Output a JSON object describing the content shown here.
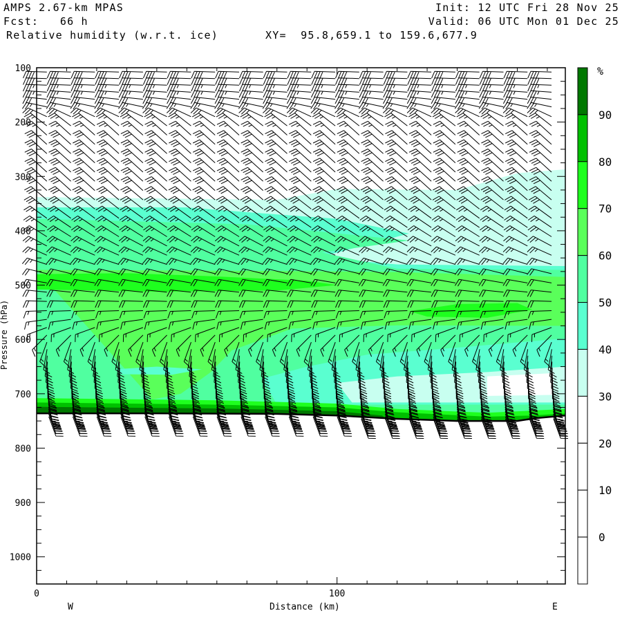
{
  "header": {
    "model": "AMPS 2.67-km MPAS",
    "forecast": "Fcst:   66 h",
    "field": "Relative humidity (w.r.t. ice)",
    "xy": "XY=  95.8,659.1 to 159.6,677.9",
    "init": "Init: 12 UTC Fri 28 Nov 25",
    "valid": "Valid: 06 UTC Mon 01 Dec 25"
  },
  "chart_data": {
    "type": "cross-section",
    "title": "Relative humidity (w.r.t. ice)",
    "xlabel": "Distance (km)",
    "ylabel": "Pressure (hPa)",
    "xlim": [
      0,
      176
    ],
    "ylim": [
      1050,
      100
    ],
    "x_ticks": [
      {
        "value": 0,
        "label": "0"
      },
      {
        "value": 100,
        "label": "100"
      }
    ],
    "x_minor_step": 10,
    "y_ticks": [
      {
        "value": 100,
        "label": "100"
      },
      {
        "value": 200,
        "label": "200"
      },
      {
        "value": 300,
        "label": "300"
      },
      {
        "value": 400,
        "label": "400"
      },
      {
        "value": 500,
        "label": "500"
      },
      {
        "value": 600,
        "label": "600"
      },
      {
        "value": 700,
        "label": "700"
      },
      {
        "value": 800,
        "label": "800"
      },
      {
        "value": 900,
        "label": "900"
      },
      {
        "value": 1000,
        "label": "1000"
      }
    ],
    "west_label": "W",
    "east_label": "E",
    "colorbar": {
      "unit": "%",
      "bins": [
        {
          "lo": 90,
          "hi": 100,
          "color": "#007800"
        },
        {
          "lo": 80,
          "hi": 90,
          "color": "#00c000"
        },
        {
          "lo": 70,
          "hi": 80,
          "color": "#1eff1e"
        },
        {
          "lo": 60,
          "hi": 70,
          "color": "#5aff5a"
        },
        {
          "lo": 50,
          "hi": 60,
          "color": "#50ffa0"
        },
        {
          "lo": 40,
          "hi": 50,
          "color": "#5affd0"
        },
        {
          "lo": 30,
          "hi": 40,
          "color": "#c8fff0"
        },
        {
          "lo": 20,
          "hi": 30,
          "color": "#ffffff"
        },
        {
          "lo": 10,
          "hi": 20,
          "color": "#ffffff"
        },
        {
          "lo": 0,
          "hi": 10,
          "color": "#ffffff"
        },
        {
          "lo": -10,
          "hi": 0,
          "color": "#ffffff"
        }
      ],
      "labels": [
        "90",
        "80",
        "70",
        "60",
        "50",
        "40",
        "30",
        "20",
        "10",
        "0"
      ]
    },
    "rh_regions": [
      {
        "rh": 35,
        "color": "#c8fff0",
        "pts": [
          [
            0,
            338
          ],
          [
            80,
            343
          ],
          [
            100,
            323
          ],
          [
            140,
            325
          ],
          [
            160,
            294
          ],
          [
            176,
            287
          ],
          [
            176,
            1050
          ],
          [
            0,
            1050
          ]
        ]
      },
      {
        "rh": 45,
        "color": "#5affd0",
        "pts": [
          [
            0,
            357
          ],
          [
            50,
            357
          ],
          [
            80,
            370
          ],
          [
            100,
            378
          ],
          [
            124,
            405
          ],
          [
            94,
            449
          ],
          [
            120,
            462
          ],
          [
            176,
            465
          ],
          [
            176,
            1050
          ],
          [
            0,
            1050
          ]
        ]
      },
      {
        "rh": 55,
        "color": "#50ffa0",
        "pts": [
          [
            0,
            378
          ],
          [
            70,
            388
          ],
          [
            124,
            418
          ],
          [
            95,
            440
          ],
          [
            120,
            470
          ],
          [
            176,
            472
          ],
          [
            176,
            1050
          ],
          [
            0,
            1050
          ]
        ]
      },
      {
        "rh": 65,
        "color": "#5aff5a",
        "pts": [
          [
            0,
            472
          ],
          [
            80,
            474
          ],
          [
            120,
            476
          ],
          [
            176,
            485
          ],
          [
            176,
            575
          ],
          [
            120,
            574
          ],
          [
            85,
            580
          ],
          [
            65,
            620
          ],
          [
            58,
            660
          ],
          [
            48,
            700
          ],
          [
            30,
            720
          ],
          [
            0,
            725
          ],
          [
            0,
            1050
          ],
          [
            40,
            1050
          ],
          [
            40,
            720
          ]
        ]
      },
      {
        "rh": 75,
        "color": "#1eff1e",
        "pts": [
          [
            0,
            480
          ],
          [
            30,
            478
          ],
          [
            60,
            484
          ],
          [
            90,
            492
          ],
          [
            100,
            500
          ],
          [
            80,
            510
          ],
          [
            40,
            512
          ],
          [
            0,
            508
          ]
        ]
      },
      {
        "rh": 75,
        "color": "#1eff1e",
        "pts": [
          [
            124,
            548
          ],
          [
            140,
            535
          ],
          [
            160,
            533
          ],
          [
            165,
            545
          ],
          [
            150,
            560
          ],
          [
            130,
            558
          ]
        ]
      },
      {
        "rh": 45,
        "color": "#5affd0",
        "pts": [
          [
            176,
            598
          ],
          [
            140,
            615
          ],
          [
            110,
            628
          ],
          [
            90,
            650
          ],
          [
            75,
            672
          ],
          [
            80,
            720
          ],
          [
            176,
            720
          ]
        ]
      },
      {
        "rh": 45,
        "color": "#5affd0",
        "pts": [
          [
            26,
            655
          ],
          [
            40,
            650
          ],
          [
            55,
            655
          ],
          [
            45,
            665
          ],
          [
            28,
            664
          ]
        ]
      },
      {
        "rh": 35,
        "color": "#c8fff0",
        "pts": [
          [
            176,
            650
          ],
          [
            150,
            660
          ],
          [
            120,
            668
          ],
          [
            100,
            680
          ],
          [
            105,
            716
          ],
          [
            176,
            716
          ]
        ]
      },
      {
        "rh": 25,
        "color": "#ffffff",
        "pts": [
          [
            150,
            668
          ],
          [
            172,
            662
          ],
          [
            172,
            702
          ],
          [
            150,
            704
          ]
        ]
      },
      {
        "rh": 75,
        "color": "#1eff1e",
        "pts": [
          [
            0,
            708
          ],
          [
            60,
            712
          ],
          [
            100,
            718
          ],
          [
            120,
            728
          ],
          [
            150,
            735
          ],
          [
            176,
            728
          ],
          [
            176,
            760
          ],
          [
            0,
            760
          ]
        ]
      },
      {
        "rh": 85,
        "color": "#00c000",
        "pts": [
          [
            0,
            716
          ],
          [
            60,
            720
          ],
          [
            100,
            725
          ],
          [
            120,
            734
          ],
          [
            150,
            742
          ],
          [
            165,
            740
          ],
          [
            176,
            736
          ],
          [
            176,
            760
          ],
          [
            0,
            760
          ]
        ]
      },
      {
        "rh": 95,
        "color": "#007800",
        "pts": [
          [
            0,
            724
          ],
          [
            60,
            727
          ],
          [
            100,
            732
          ],
          [
            115,
            740
          ],
          [
            120,
            760
          ],
          [
            0,
            760
          ]
        ]
      }
    ],
    "terrain": [
      [
        0,
        736
      ],
      [
        40,
        736
      ],
      [
        80,
        737
      ],
      [
        100,
        740
      ],
      [
        120,
        746
      ],
      [
        140,
        750
      ],
      [
        160,
        750
      ],
      [
        166,
        745
      ],
      [
        176,
        740
      ]
    ],
    "wind_columns": {
      "start_km": 3.4,
      "step_km": 8.0,
      "count": 22
    },
    "wind_levels": [
      {
        "p": 108,
        "dir": 272,
        "spd": 40
      },
      {
        "p": 120,
        "dir": 272,
        "spd": 40
      },
      {
        "p": 132,
        "dir": 272,
        "spd": 35
      },
      {
        "p": 145,
        "dir": 274,
        "spd": 35
      },
      {
        "p": 158,
        "dir": 276,
        "spd": 30
      },
      {
        "p": 172,
        "dir": 282,
        "spd": 25
      },
      {
        "p": 190,
        "dir": 295,
        "spd": 25
      },
      {
        "p": 207,
        "dir": 308,
        "spd": 25
      },
      {
        "p": 224,
        "dir": 312,
        "spd": 25
      },
      {
        "p": 241,
        "dir": 312,
        "spd": 30
      },
      {
        "p": 258,
        "dir": 312,
        "spd": 30
      },
      {
        "p": 275,
        "dir": 312,
        "spd": 30
      },
      {
        "p": 292,
        "dir": 312,
        "spd": 30
      },
      {
        "p": 309,
        "dir": 312,
        "spd": 30
      },
      {
        "p": 326,
        "dir": 312,
        "spd": 30
      },
      {
        "p": 343,
        "dir": 310,
        "spd": 30
      },
      {
        "p": 360,
        "dir": 308,
        "spd": 30
      },
      {
        "p": 377,
        "dir": 306,
        "spd": 25
      },
      {
        "p": 394,
        "dir": 304,
        "spd": 25
      },
      {
        "p": 411,
        "dir": 302,
        "spd": 25
      },
      {
        "p": 428,
        "dir": 298,
        "spd": 25
      },
      {
        "p": 445,
        "dir": 294,
        "spd": 25
      },
      {
        "p": 462,
        "dir": 288,
        "spd": 25
      },
      {
        "p": 479,
        "dir": 284,
        "spd": 20
      },
      {
        "p": 496,
        "dir": 280,
        "spd": 20
      },
      {
        "p": 513,
        "dir": 276,
        "spd": 20
      },
      {
        "p": 530,
        "dir": 272,
        "spd": 20
      },
      {
        "p": 547,
        "dir": 268,
        "spd": 15
      },
      {
        "p": 563,
        "dir": 262,
        "spd": 15
      },
      {
        "p": 578,
        "dir": 250,
        "spd": 15
      },
      {
        "p": 592,
        "dir": 225,
        "spd": 15
      },
      {
        "p": 605,
        "dir": 200,
        "spd": 15
      },
      {
        "p": 618,
        "dir": 190,
        "spd": 15
      },
      {
        "p": 630,
        "dir": 186,
        "spd": 20
      },
      {
        "p": 641,
        "dir": 184,
        "spd": 20
      },
      {
        "p": 652,
        "dir": 182,
        "spd": 20
      },
      {
        "p": 662,
        "dir": 180,
        "spd": 20
      },
      {
        "p": 671,
        "dir": 180,
        "spd": 25
      },
      {
        "p": 680,
        "dir": 178,
        "spd": 25
      },
      {
        "p": 688,
        "dir": 176,
        "spd": 25
      },
      {
        "p": 695,
        "dir": 175,
        "spd": 30
      },
      {
        "p": 702,
        "dir": 174,
        "spd": 30
      },
      {
        "p": 708,
        "dir": 172,
        "spd": 30
      },
      {
        "p": 714,
        "dir": 170,
        "spd": 30
      },
      {
        "p": 719,
        "dir": 168,
        "spd": 35
      },
      {
        "p": 724,
        "dir": 166,
        "spd": 35
      },
      {
        "p": 728,
        "dir": 164,
        "spd": 35
      },
      {
        "p": 732,
        "dir": 162,
        "spd": 35
      },
      {
        "p": 737,
        "dir": 160,
        "spd": 35
      },
      {
        "p": 742,
        "dir": 160,
        "spd": 35
      },
      {
        "p": 746,
        "dir": 160,
        "spd": 35
      }
    ]
  }
}
